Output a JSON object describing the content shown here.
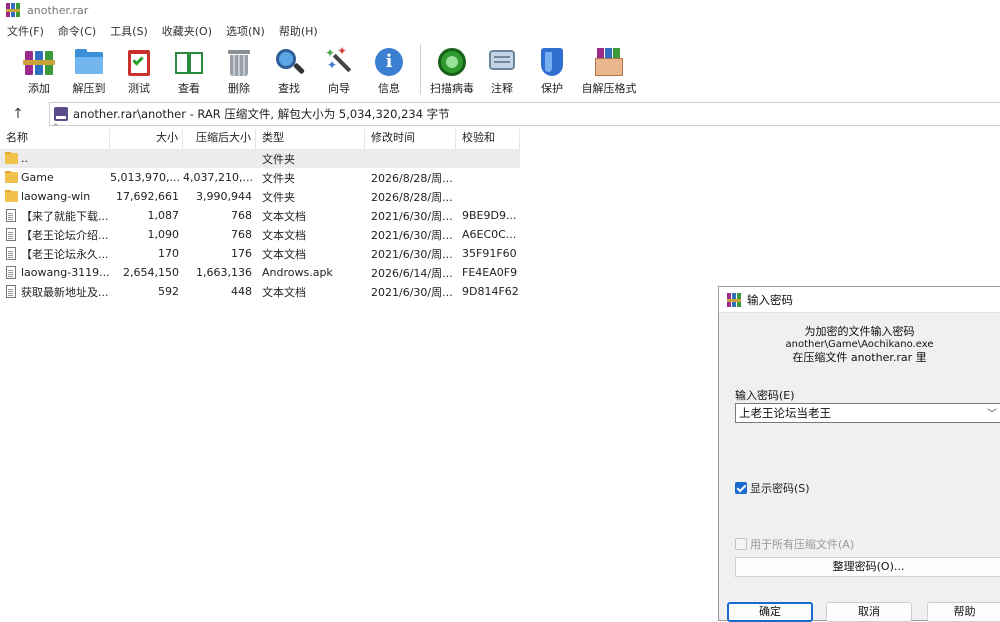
{
  "window": {
    "title": "another.rar"
  },
  "menu": [
    "文件(F)",
    "命令(C)",
    "工具(S)",
    "收藏夹(O)",
    "选项(N)",
    "帮助(H)"
  ],
  "toolbar": [
    {
      "label": "添加",
      "icon": "add-archive-icon"
    },
    {
      "label": "解压到",
      "icon": "extract-to-icon"
    },
    {
      "label": "测试",
      "icon": "test-icon"
    },
    {
      "label": "查看",
      "icon": "view-icon"
    },
    {
      "label": "删除",
      "icon": "delete-icon"
    },
    {
      "label": "查找",
      "icon": "find-icon"
    },
    {
      "label": "向导",
      "icon": "wizard-icon"
    },
    {
      "label": "信息",
      "icon": "info-icon"
    },
    {
      "label": "扫描病毒",
      "icon": "scan-virus-icon"
    },
    {
      "label": "注释",
      "icon": "comment-icon"
    },
    {
      "label": "保护",
      "icon": "protect-icon"
    },
    {
      "label": "自解压格式",
      "icon": "sfx-icon"
    }
  ],
  "address": {
    "text": "another.rar\\another - RAR 压缩文件, 解包大小为 5,034,320,234 字节"
  },
  "columns": [
    "名称",
    "大小",
    "压缩后大小",
    "类型",
    "修改时间",
    "校验和"
  ],
  "files": [
    {
      "name": "..",
      "size": "",
      "packed": "",
      "type": "文件夹",
      "mtime": "",
      "crc": "",
      "kind": "folder"
    },
    {
      "name": "Game",
      "size": "5,013,970,...",
      "packed": "4,037,210,...",
      "type": "文件夹",
      "mtime": "2026/8/28/周...",
      "crc": "",
      "kind": "folder"
    },
    {
      "name": "laowang-win",
      "size": "17,692,661",
      "packed": "3,990,944",
      "type": "文件夹",
      "mtime": "2026/8/28/周...",
      "crc": "",
      "kind": "folder"
    },
    {
      "name": "【来了就能下载...",
      "size": "1,087",
      "packed": "768",
      "type": "文本文档",
      "mtime": "2021/6/30/周...",
      "crc": "9BE9D9...",
      "kind": "doc"
    },
    {
      "name": "【老王论坛介绍...",
      "size": "1,090",
      "packed": "768",
      "type": "文本文档",
      "mtime": "2021/6/30/周...",
      "crc": "A6EC0C...",
      "kind": "doc"
    },
    {
      "name": "【老王论坛永久...",
      "size": "170",
      "packed": "176",
      "type": "文本文档",
      "mtime": "2021/6/30/周...",
      "crc": "35F91F60",
      "kind": "doc"
    },
    {
      "name": "laowang-3119...",
      "size": "2,654,150",
      "packed": "1,663,136",
      "type": "Androws.apk",
      "mtime": "2026/6/14/周...",
      "crc": "FE4EA0F9",
      "kind": "doc"
    },
    {
      "name": "获取最新地址及...",
      "size": "592",
      "packed": "448",
      "type": "文本文档",
      "mtime": "2021/6/30/周...",
      "crc": "9D814F62",
      "kind": "doc"
    }
  ],
  "dialog": {
    "title": "输入密码",
    "msg1": "为加密的文件输入密码",
    "msg_path": "another\\Game\\Aochikano.exe",
    "msg3": "在压缩文件 another.rar 里",
    "label": "输入密码(E)",
    "password": "上老王论坛当老王",
    "show_password": "显示密码(S)",
    "use_all": "用于所有压缩文件(A)",
    "organize": "整理密码(O)...",
    "ok": "确定",
    "cancel": "取消",
    "help": "帮助"
  }
}
